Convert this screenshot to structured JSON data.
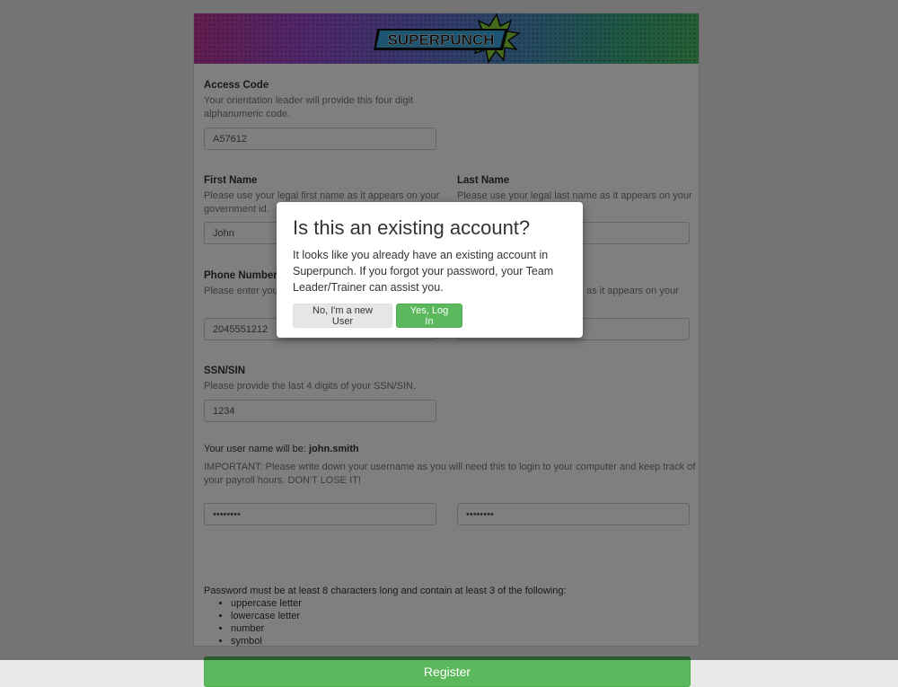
{
  "brand": {
    "logo_text": "SUPERPUNCH"
  },
  "form": {
    "access_code": {
      "label": "Access Code",
      "help_line1": "Your orientation leader will provide this four digit",
      "help_line2": "alphanumeric code.",
      "value": "A57612"
    },
    "first_name": {
      "label": "First Name",
      "help_line1": "Please use your legal first name as it appears on your",
      "help_line2": "government id.",
      "value": "John"
    },
    "last_name": {
      "label": "Last Name",
      "help_line1": "Please use your legal last name as it appears on your",
      "value": ""
    },
    "phone": {
      "label": "Phone Number",
      "help_line1": "Please enter you",
      "value": "2045551212"
    },
    "right_field": {
      "help_line1": "as it appears on your",
      "value": ""
    },
    "ssn": {
      "label": "SSN/SIN",
      "help": "Please provide the last 4 digits of your SSN/SIN.",
      "value": "1234"
    },
    "username": {
      "prefix": "Your user name will be: ",
      "value": "john.smith",
      "important_line1": "IMPORTANT: Please write down your username as you will need this to login to your computer and keep track of",
      "important_line2": "your payroll hours. DON'T LOSE IT!"
    },
    "password": {
      "value": "password"
    },
    "password_confirm": {
      "value": "password"
    },
    "password_rules": {
      "intro": "Password must be at least 8 characters long and contain at least 3 of the following:",
      "items": [
        "uppercase letter",
        "lowercase letter",
        "number",
        "symbol"
      ]
    },
    "register_label": "Register"
  },
  "modal": {
    "title": "Is this an existing account?",
    "body": "It looks like you already have an existing account in Superpunch. If you forgot your password, your Team Leader/Trainer can assist you.",
    "no_label": "No, I'm a new User",
    "yes_label": "Yes, Log In"
  },
  "colors": {
    "page_bg": "#e9e9e9",
    "success": "#5cb85c",
    "logo_blue": "#3aa9e0",
    "logo_burst": "#8bd63b"
  }
}
